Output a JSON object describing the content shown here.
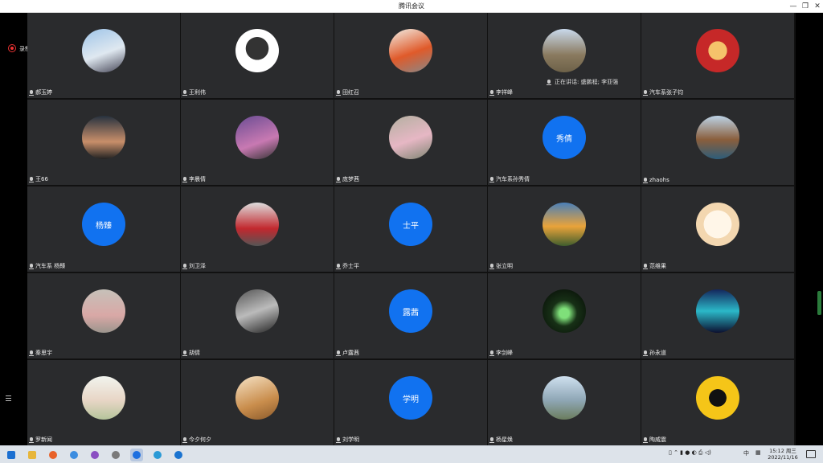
{
  "window": {
    "title": "腾讯会议",
    "minimize_glyph": "—",
    "maximize_glyph": "❐",
    "close_glyph": "✕"
  },
  "recording": {
    "label": "录制中",
    "icon": "record-icon",
    "color": "#e33333"
  },
  "speaking": {
    "label": "正在讲话: 盛鹏程; 李亚强"
  },
  "accent_color": "#1172f0",
  "participants": [
    {
      "name": "郝玉婷",
      "avatar": "photo"
    },
    {
      "name": "王利伟",
      "avatar": "photo"
    },
    {
      "name": "田红召",
      "avatar": "photo"
    },
    {
      "name": "李祥峰",
      "avatar": "photo"
    },
    {
      "name": "汽车系张子钧",
      "avatar": "photo"
    },
    {
      "name": "王66",
      "avatar": "photo"
    },
    {
      "name": "李晨倩",
      "avatar": "photo"
    },
    {
      "name": "庞梦茜",
      "avatar": "photo"
    },
    {
      "name": "汽车系孙秀倩",
      "avatar": "text",
      "initials": "秀倩"
    },
    {
      "name": "zhaohs",
      "avatar": "photo"
    },
    {
      "name": "汽车系 杨臻",
      "avatar": "text",
      "initials": "杨臻"
    },
    {
      "name": "刘卫泽",
      "avatar": "photo"
    },
    {
      "name": "乔士平",
      "avatar": "text",
      "initials": "士平"
    },
    {
      "name": "张立明",
      "avatar": "photo"
    },
    {
      "name": "范维果",
      "avatar": "photo"
    },
    {
      "name": "秦思宇",
      "avatar": "photo"
    },
    {
      "name": "胡倩",
      "avatar": "photo"
    },
    {
      "name": "卢露茜",
      "avatar": "text",
      "initials": "露茜"
    },
    {
      "name": "李剑峰",
      "avatar": "photo"
    },
    {
      "name": "孙永道",
      "avatar": "photo"
    },
    {
      "name": "罗新闻",
      "avatar": "photo"
    },
    {
      "name": "今夕何夕",
      "avatar": "photo"
    },
    {
      "name": "刘学明",
      "avatar": "text",
      "initials": "学明"
    },
    {
      "name": "杨星焕",
      "avatar": "photo"
    },
    {
      "name": "陶威震",
      "avatar": "photo"
    }
  ],
  "taskbar": {
    "apps": [
      "start-icon",
      "file-explorer-icon",
      "firefox-icon",
      "chrome-icon",
      "app-icon",
      "app-icon",
      "tencent-meeting-icon",
      "app-icon",
      "edge-icon"
    ],
    "ime_label": "中",
    "time": "15:12 周三",
    "date": "2022/11/16"
  }
}
